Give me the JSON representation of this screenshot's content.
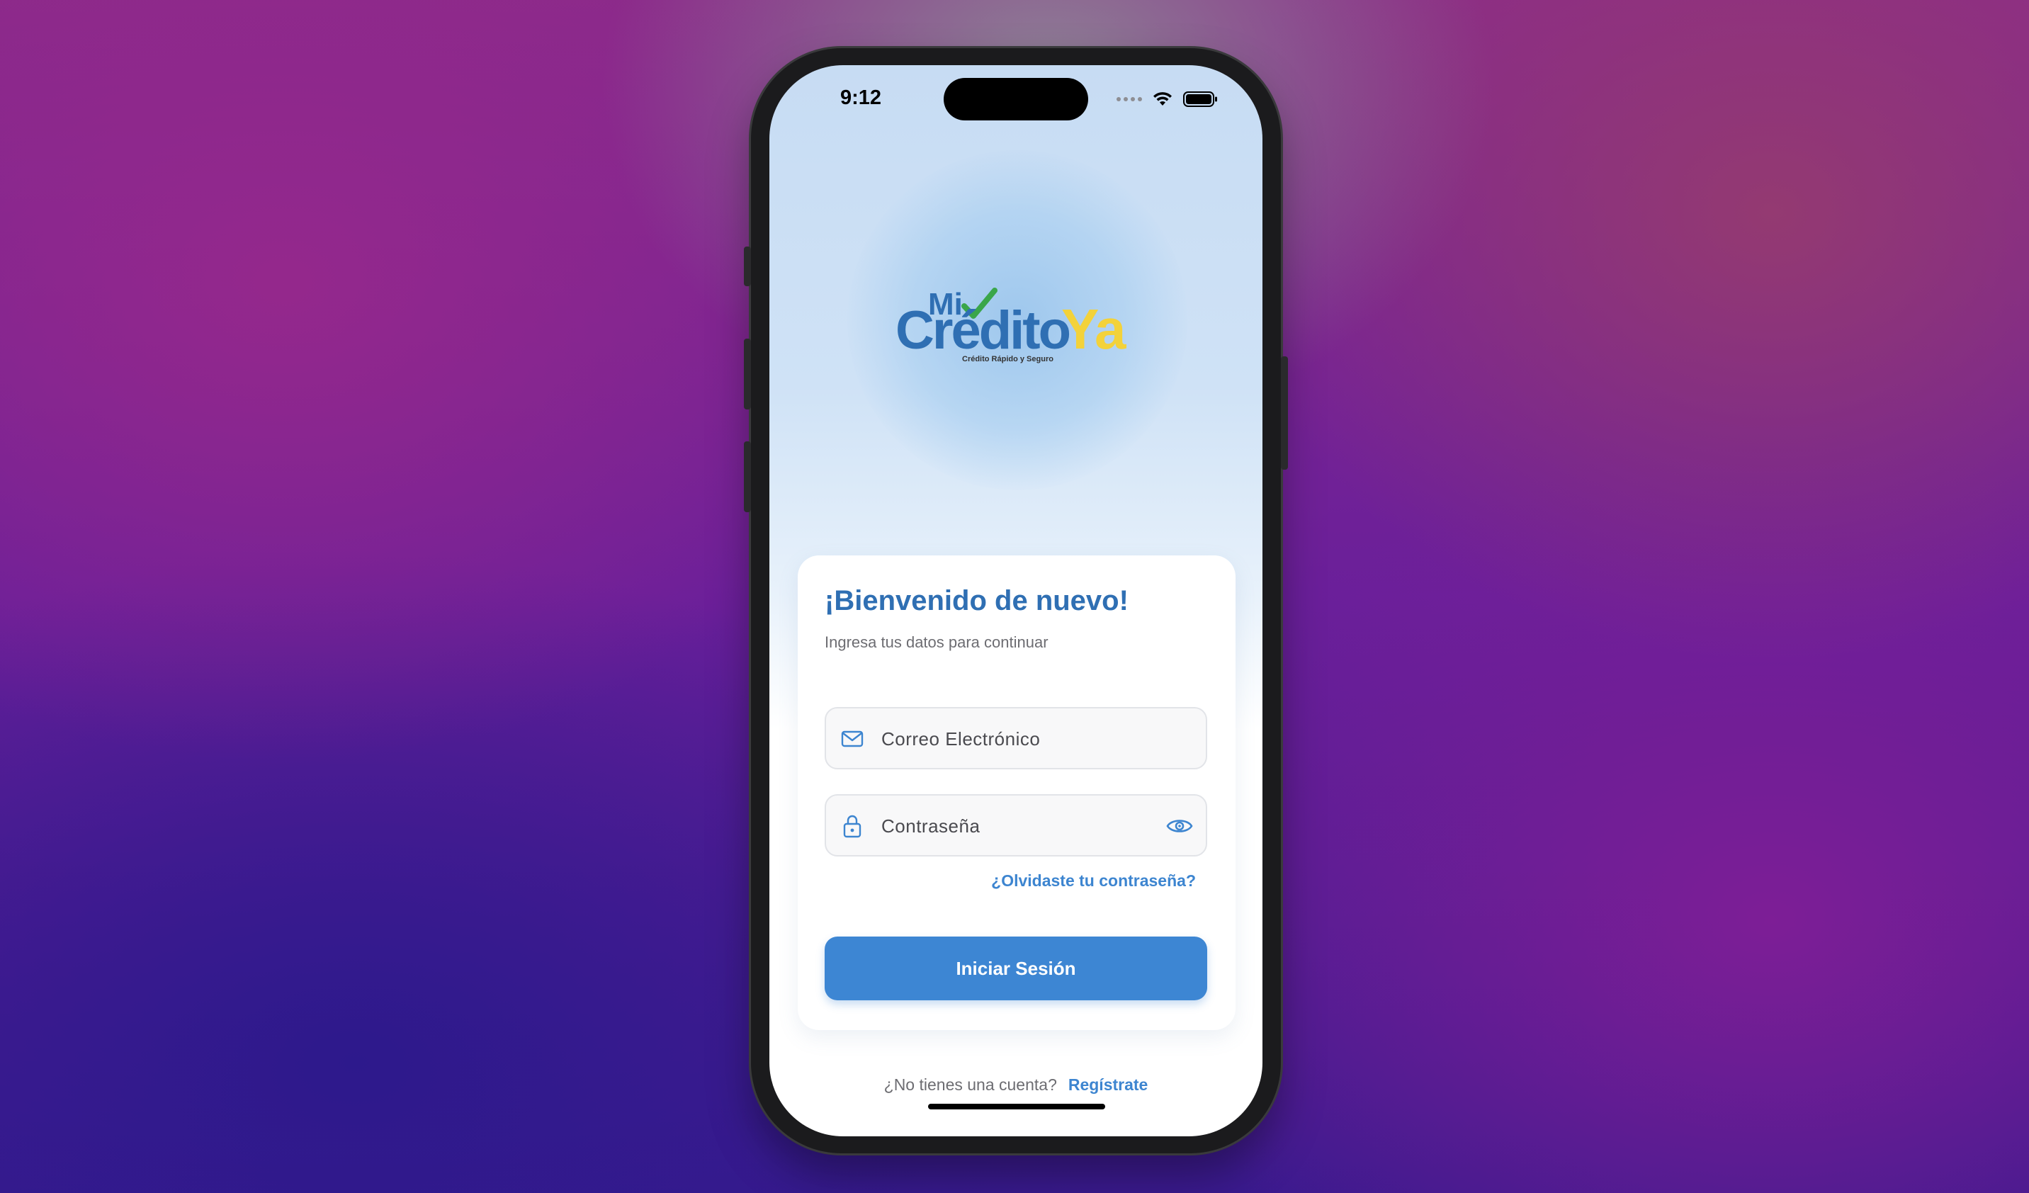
{
  "status_bar": {
    "time": "9:12"
  },
  "logo": {
    "mi": "Mi",
    "credito": "Crédito",
    "ya": "Ya",
    "tagline": "Crédito Rápido y Seguro"
  },
  "card": {
    "title": "¡Bienvenido de nuevo!",
    "subtitle": "Ingresa tus datos para continuar",
    "email_placeholder": "Correo Electrónico",
    "password_placeholder": "Contraseña",
    "forgot_label": "¿Olvidaste tu contraseña?",
    "login_label": "Iniciar Sesión"
  },
  "signup": {
    "question": "¿No tienes una cuenta?",
    "link": "Regístrate"
  },
  "icons": {
    "email": "mail-icon",
    "password": "lock-icon",
    "visibility": "eye-icon"
  },
  "colors": {
    "primary": "#3d86d3",
    "title": "#2f6fb3",
    "logo_yellow": "#f3d23a",
    "logo_check": "#3aa64a"
  }
}
